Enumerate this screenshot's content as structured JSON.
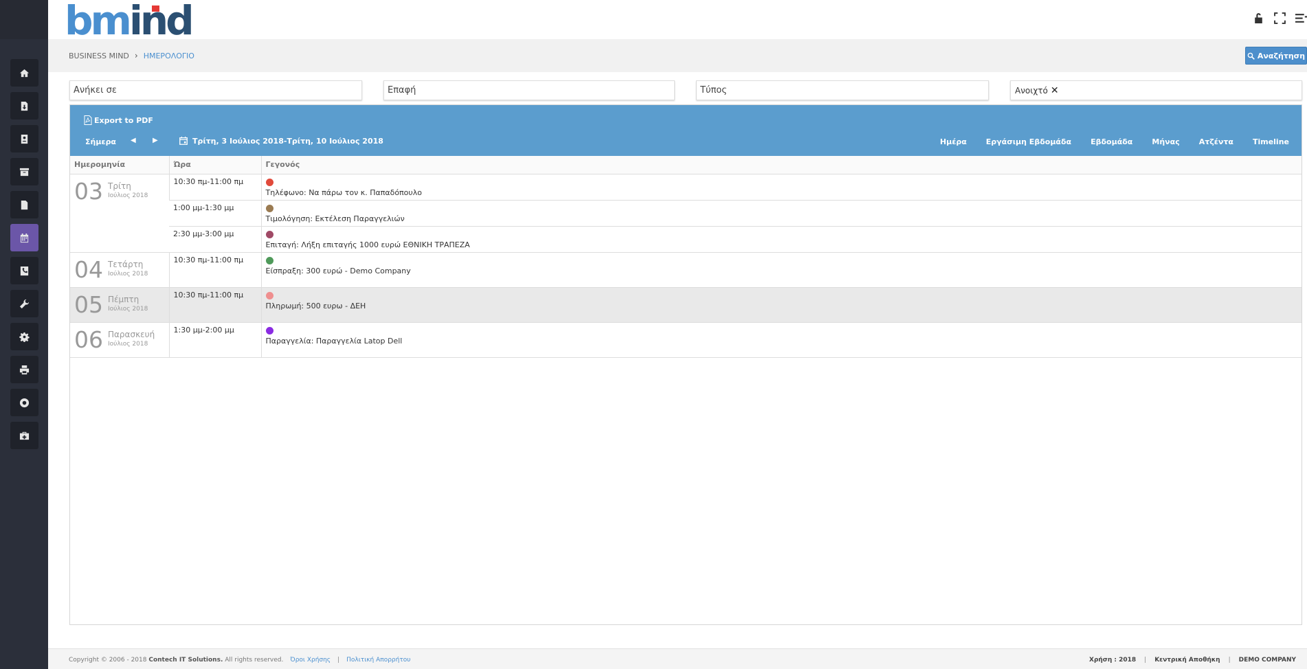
{
  "brand": {
    "logo_text": "bmind",
    "logo_colors": {
      "b": "#4a8fcf",
      "m": "#4a8fcf",
      "i_dot": "#e53935",
      "rest": "#2b4f72"
    }
  },
  "header_icons": [
    "lock-icon",
    "fullscreen-icon",
    "menu-icon"
  ],
  "sidebar": {
    "active_index": 5,
    "items": [
      {
        "name": "home-icon"
      },
      {
        "name": "download-doc-icon"
      },
      {
        "name": "contacts-icon"
      },
      {
        "name": "archive-icon"
      },
      {
        "name": "document-icon"
      },
      {
        "name": "calendar-icon"
      },
      {
        "name": "phone-icon"
      },
      {
        "name": "wrench-icon"
      },
      {
        "name": "gear-icon"
      },
      {
        "name": "print-icon"
      },
      {
        "name": "support-icon"
      },
      {
        "name": "toolbox-icon"
      }
    ]
  },
  "breadcrumb": {
    "root": "BUSINESS MIND",
    "separator": "›",
    "current": "ΗΜΕΡΟΛΟΓΙΟ"
  },
  "search_button": {
    "label": "Αναζήτηση"
  },
  "filters": {
    "belongs_to": "Ανήκει σε",
    "contact": "Επαφή",
    "type": "Τύπος",
    "status_tag": "Ανοιχτό"
  },
  "calendar": {
    "export_label": "Export to PDF",
    "today_label": "Σήμερα",
    "prev_label": "◀",
    "next_label": "▶",
    "range_label": "Τρίτη, 3 Ιούλιος 2018-Τρίτη, 10 Ιούλιος 2018",
    "views": [
      "Ημέρα",
      "Εργάσιμη Εβδομάδα",
      "Εβδομάδα",
      "Μήνας",
      "Ατζέντα",
      "Timeline"
    ],
    "columns": {
      "date": "Ημερομηνία",
      "time": "Ώρα",
      "event": "Γεγονός"
    },
    "days": [
      {
        "num": "03",
        "name": "Τρίτη",
        "month": "Ιούλιος 2018",
        "events": [
          {
            "time": "10:30 πμ-11:00 πμ",
            "color": "#e14a3b",
            "title": "Τηλέφωνο: Να πάρω τον κ. Παπαδόπουλο"
          },
          {
            "time": "1:00 μμ-1:30 μμ",
            "color": "#9b7b52",
            "title": "Τιμολόγηση: Εκτέλεση Παραγγελιών"
          },
          {
            "time": "2:30 μμ-3:00 μμ",
            "color": "#a04a66",
            "title": "Επιταγή: Λήξη επιταγής 1000 ευρώ ΕΘΝΙΚΗ ΤΡΑΠΕΖΑ"
          }
        ]
      },
      {
        "num": "04",
        "name": "Τετάρτη",
        "month": "Ιούλιος 2018",
        "events": [
          {
            "time": "10:30 πμ-11:00 πμ",
            "color": "#4f9a5a",
            "title": "Είσπραξη: 300 ευρώ - Demo Company"
          }
        ]
      },
      {
        "num": "05",
        "name": "Πέμπτη",
        "month": "Ιούλιος 2018",
        "shaded": true,
        "events": [
          {
            "time": "10:30 πμ-11:00 πμ",
            "color": "#ef8f8f",
            "title": "Πληρωμή: 500 ευρω - ΔΕΗ"
          }
        ]
      },
      {
        "num": "06",
        "name": "Παρασκευή",
        "month": "Ιούλιος 2018",
        "events": [
          {
            "time": "1:30 μμ-2:00 μμ",
            "color": "#8a2be2",
            "title": "Παραγγελία: Παραγγελία Latop Dell"
          }
        ]
      }
    ]
  },
  "footer": {
    "copyright": "Copyright © 2006 - 2018",
    "company": "Contech IT Solutions.",
    "rights": "All rights reserved.",
    "terms": "Όροι Χρήσης",
    "divider": "|",
    "privacy": "Πολιτική Απορρήτου",
    "year_label": "Χρήση : 2018",
    "warehouse": "Κεντρική Αποθήκη",
    "company_name": "DEMO COMPANY"
  }
}
